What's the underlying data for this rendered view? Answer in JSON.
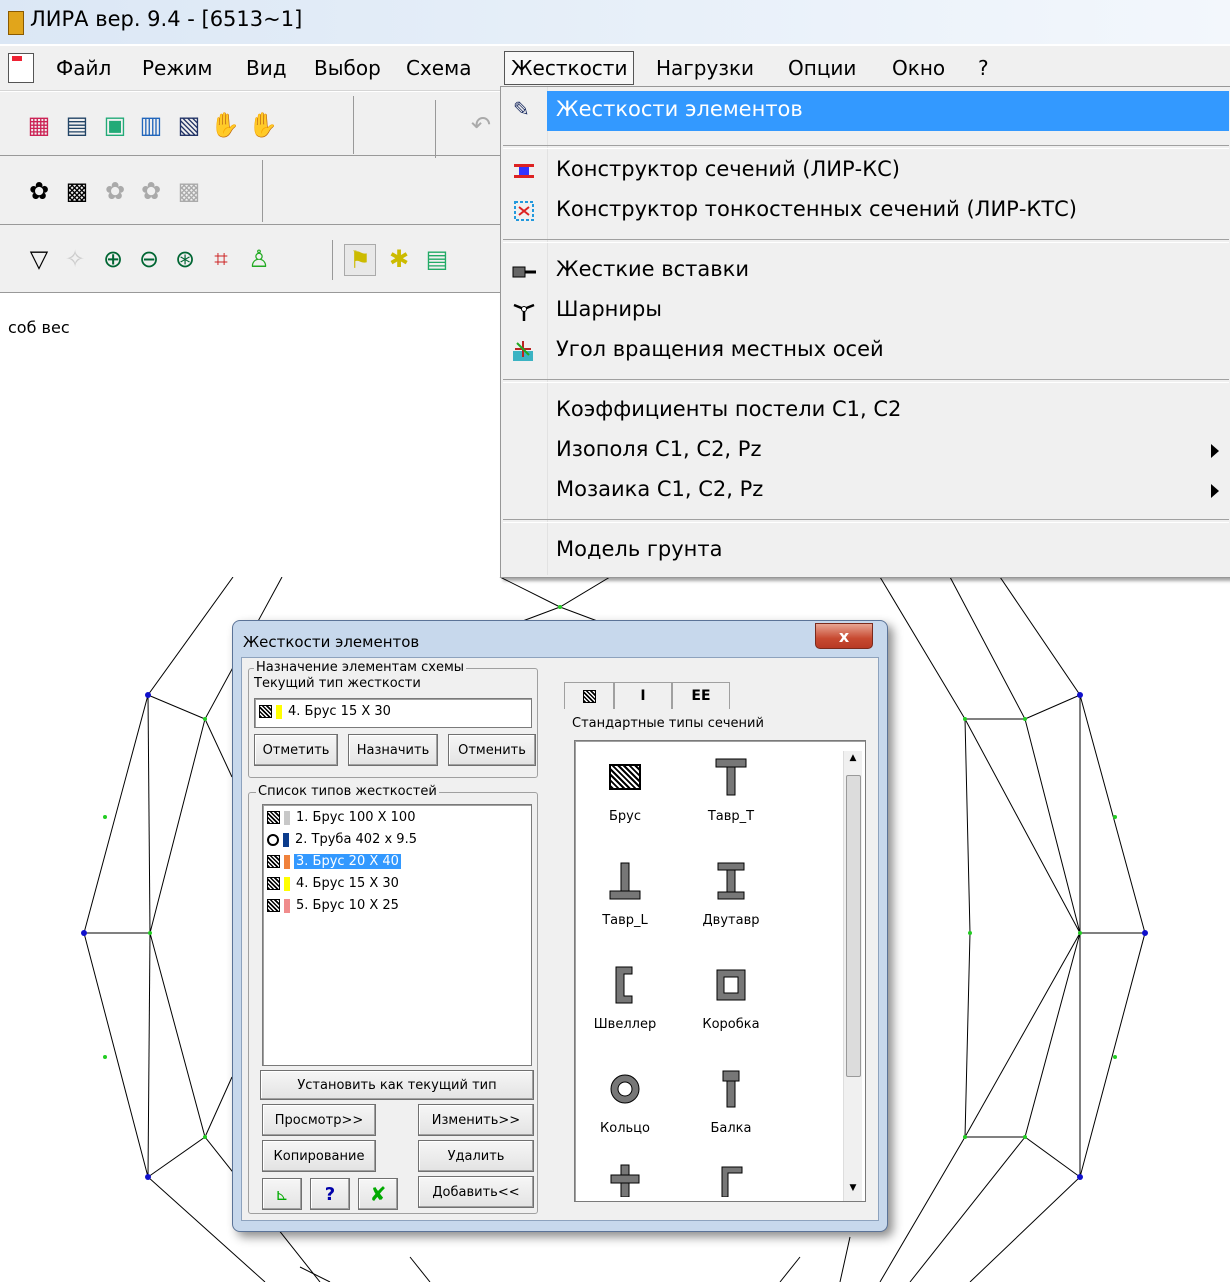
{
  "window": {
    "title": "ЛИРА  вер. 9.4 - [6513~1]"
  },
  "menubar": [
    {
      "label": "Файл"
    },
    {
      "label": "Режим"
    },
    {
      "label": "Вид"
    },
    {
      "label": "Выбор"
    },
    {
      "label": "Схема"
    },
    {
      "label": "Жесткости"
    },
    {
      "label": "Нагрузки"
    },
    {
      "label": "Опции"
    },
    {
      "label": "Окно"
    },
    {
      "label": "?"
    }
  ],
  "status_label": "соб вес",
  "dropdown": {
    "items": [
      {
        "label": "Жесткости элементов",
        "icon": "stiffness-icon"
      },
      {
        "label": "Конструктор сечений (ЛИР-КС)",
        "icon": "section-constructor-icon"
      },
      {
        "label": "Конструктор тонкостенных сечений (ЛИР-КТС)",
        "icon": "thinwall-constructor-icon"
      },
      {
        "label": "Жесткие вставки",
        "icon": "rigid-insert-icon"
      },
      {
        "label": "Шарниры",
        "icon": "hinge-icon"
      },
      {
        "label": "Угол вращения местных осей",
        "icon": "axes-rotation-icon"
      },
      {
        "label": "Коэффициенты постели С1, С2"
      },
      {
        "label": "Изополя С1, С2, Pz",
        "submenu": true
      },
      {
        "label": "Мозаика С1, С2, Pz",
        "submenu": true
      },
      {
        "label": "Модель грунта"
      }
    ]
  },
  "dialog": {
    "title": "Жесткости элементов",
    "close": "x",
    "assign_group": {
      "title": "Назначение элементам схемы",
      "current_label": "Текущий тип жесткости",
      "current_value": "4. Брус 15 X 30",
      "current_color": "#ffff00",
      "btn_mark": "Отметить",
      "btn_assign": "Назначить",
      "btn_cancel": "Отменить"
    },
    "list_group": {
      "title": "Список типов жесткостей",
      "items": [
        {
          "label": "1. Брус 100 X 100",
          "color": "#c8c8c8",
          "shape": "hatch"
        },
        {
          "label": "2. Труба 402 x 9.5",
          "color": "#0b3c8c",
          "shape": "ring"
        },
        {
          "label": "3. Брус 20 X 40",
          "color": "#f0823c",
          "shape": "hatch",
          "selected": true
        },
        {
          "label": "4. Брус 15 X 30",
          "color": "#ffff00",
          "shape": "hatch"
        },
        {
          "label": "5. Брус 10 X 25",
          "color": "#f08c8c",
          "shape": "hatch"
        }
      ]
    },
    "btn_set_current": "Установить как текущий тип",
    "btn_view": "Просмотр>>",
    "btn_change": "Изменить>>",
    "btn_copy": "Копирование",
    "btn_delete": "Удалить",
    "btn_add": "Добавить<<",
    "btn_help": "?",
    "tabs": [
      {
        "label": "▨"
      },
      {
        "label": "I"
      },
      {
        "label": "EE"
      }
    ],
    "sections_title": "Стандартные типы сечений",
    "sections": [
      {
        "label": "Брус"
      },
      {
        "label": "Тавр_Т"
      },
      {
        "label": "Тавр_L"
      },
      {
        "label": "Двутавр"
      },
      {
        "label": "Швеллер"
      },
      {
        "label": "Коробка"
      },
      {
        "label": "Кольцо"
      },
      {
        "label": "Балка"
      }
    ]
  }
}
